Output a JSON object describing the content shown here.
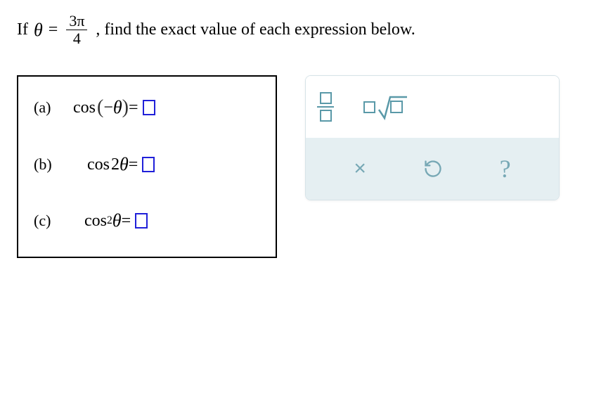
{
  "statement": {
    "prefix": "If ",
    "theta": "θ",
    "equals": " = ",
    "theta_num": "3π",
    "theta_den": "4",
    "suffix": ", find the exact value of each expression below."
  },
  "problems": {
    "a": {
      "label": "(a)",
      "cos": "cos",
      "arg_open": "(",
      "neg": "−",
      "theta": "θ",
      "arg_close": ")",
      "eq": " = "
    },
    "b": {
      "label": "(b)",
      "cos": "cos",
      "coef": "2",
      "theta": "θ",
      "eq": " = "
    },
    "c": {
      "label": "(c)",
      "cos": "cos",
      "exp": "2",
      "theta": "θ",
      "eq": " = "
    }
  },
  "toolbox": {
    "frac_tool": "fraction",
    "sqrt_tool": "square-root",
    "clear": "×",
    "reset": "↺",
    "help": "?"
  }
}
